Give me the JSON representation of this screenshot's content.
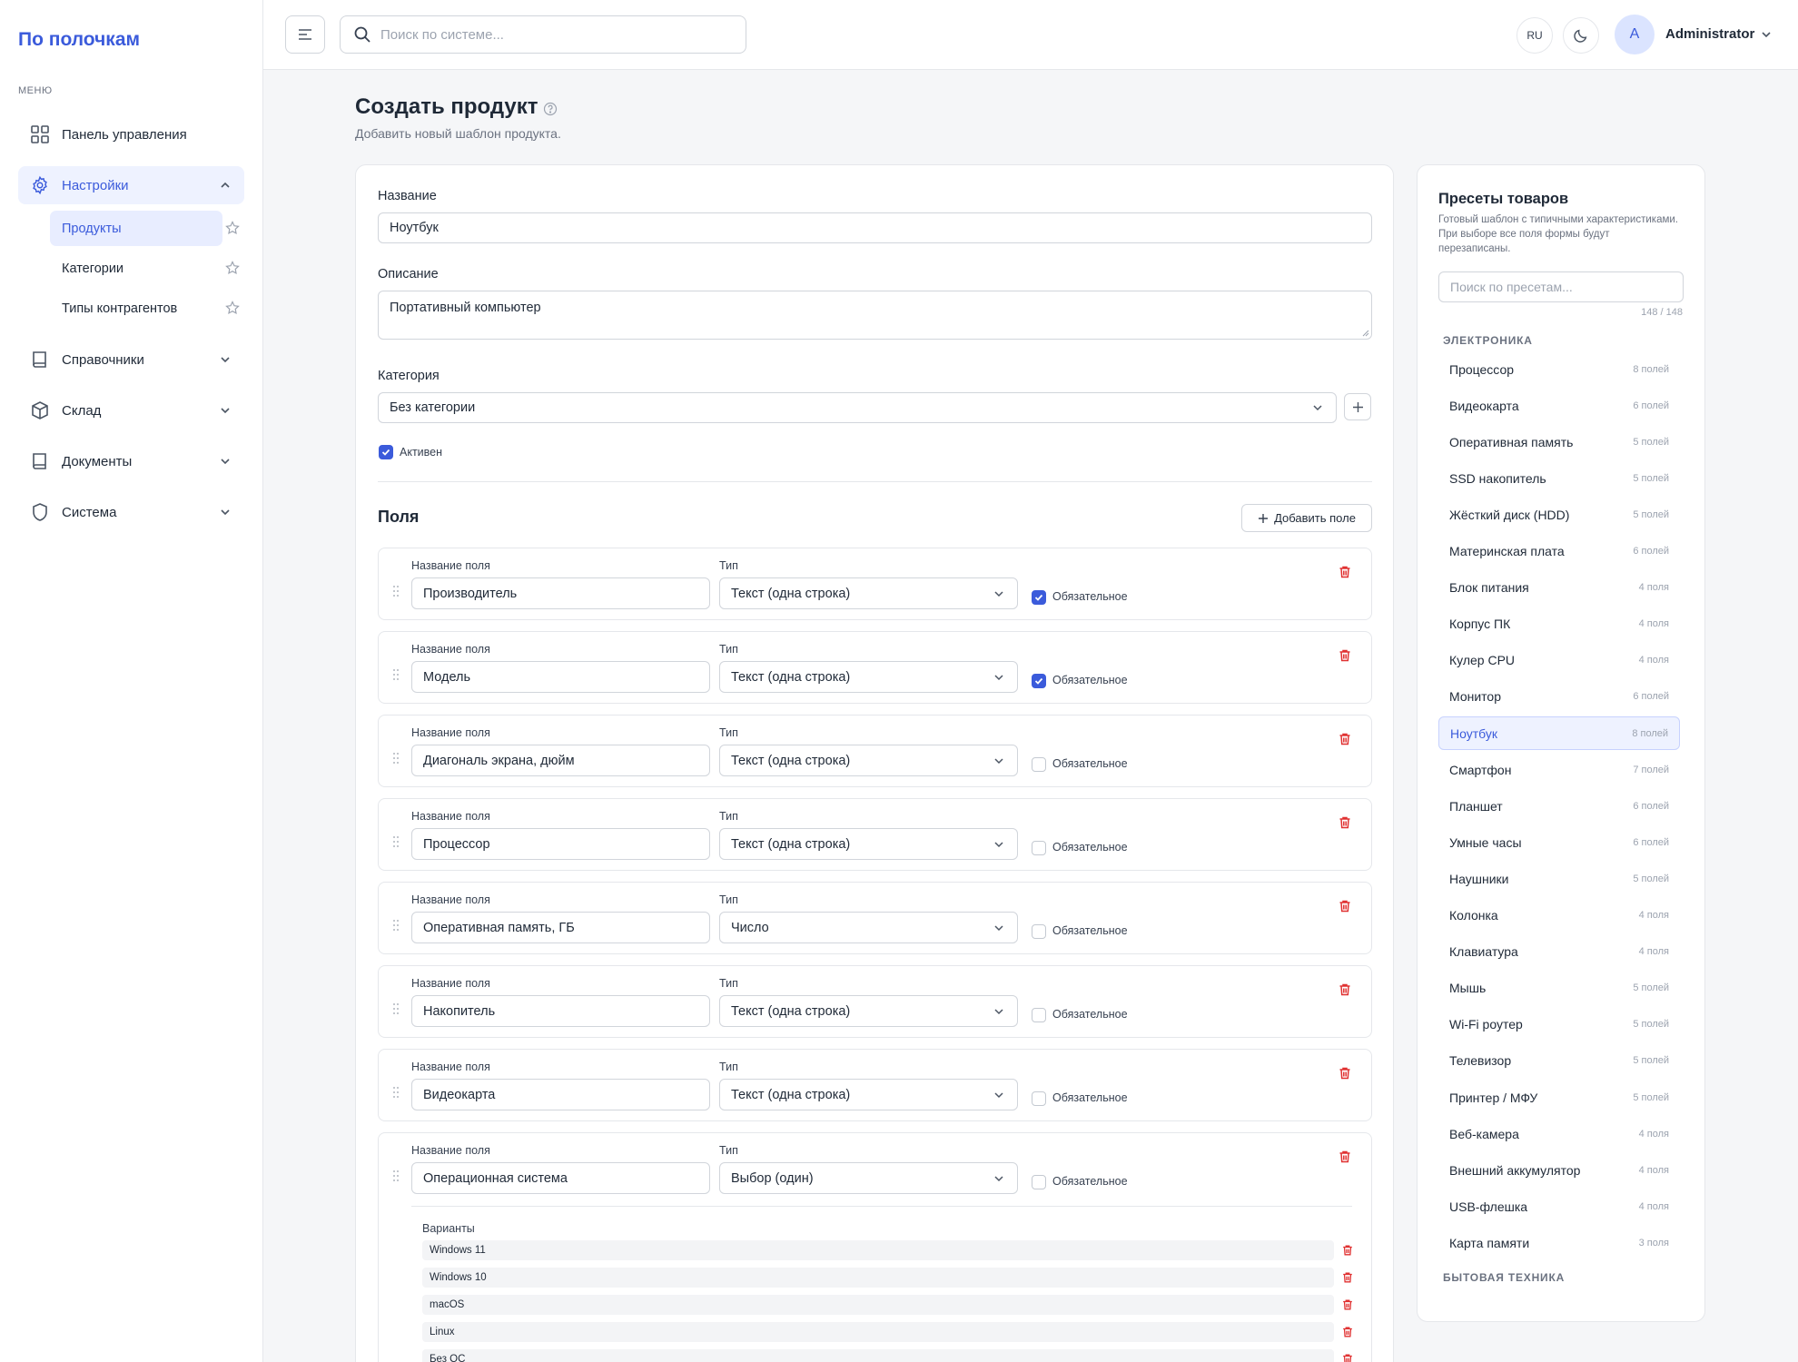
{
  "app": {
    "logo": "По полочкам",
    "menu_label": "МЕНЮ"
  },
  "nav": [
    {
      "label": "Панель управления",
      "icon": "dashboard-icon"
    },
    {
      "label": "Настройки",
      "icon": "gear-icon",
      "open": true,
      "children": [
        "Продукты",
        "Категории",
        "Типы контрагентов"
      ]
    },
    {
      "label": "Справочники",
      "icon": "book-icon"
    },
    {
      "label": "Склад",
      "icon": "box-icon"
    },
    {
      "label": "Документы",
      "icon": "document-icon"
    },
    {
      "label": "Система",
      "icon": "shield-icon"
    }
  ],
  "topbar": {
    "search_placeholder": "Поиск по системе...",
    "lang": "RU",
    "avatar_letter": "A",
    "username": "Administrator"
  },
  "page": {
    "title": "Создать продукт",
    "subtitle": "Добавить новый шаблон продукта."
  },
  "form": {
    "name_label": "Название",
    "name_value": "Ноутбук",
    "desc_label": "Описание",
    "desc_value": "Портативный компьютер",
    "category_label": "Категория",
    "category_value": "Без категории",
    "active_label": "Активен",
    "active": true,
    "fields_title": "Поля",
    "add_field_label": "Добавить поле",
    "field_name_label": "Название поля",
    "field_type_label": "Тип",
    "required_label": "Обязательное",
    "variants_label": "Варианты"
  },
  "fields": [
    {
      "name": "Производитель",
      "type": "Текст (одна строка)",
      "required": true
    },
    {
      "name": "Модель",
      "type": "Текст (одна строка)",
      "required": true
    },
    {
      "name": "Диагональ экрана, дюйм",
      "type": "Текст (одна строка)",
      "required": false
    },
    {
      "name": "Процессор",
      "type": "Текст (одна строка)",
      "required": false
    },
    {
      "name": "Оперативная память, ГБ",
      "type": "Число",
      "required": false
    },
    {
      "name": "Накопитель",
      "type": "Текст (одна строка)",
      "required": false
    },
    {
      "name": "Видеокарта",
      "type": "Текст (одна строка)",
      "required": false
    },
    {
      "name": "Операционная система",
      "type": "Выбор (один)",
      "required": false,
      "options": [
        "Windows 11",
        "Windows 10",
        "macOS",
        "Linux",
        "Без ОС"
      ]
    }
  ],
  "presets": {
    "title": "Пресеты товаров",
    "description": "Готовый шаблон с типичными характеристиками. При выборе все поля формы будут перезаписаны.",
    "search_placeholder": "Поиск по пресетам...",
    "count": "148 / 148",
    "group": "ЭЛЕКТРОНИКА",
    "next_group": "БЫТОВАЯ ТЕХНИКА",
    "items": [
      {
        "name": "Процессор",
        "count": "8 полей"
      },
      {
        "name": "Видеокарта",
        "count": "6 полей"
      },
      {
        "name": "Оперативная память",
        "count": "5 полей"
      },
      {
        "name": "SSD накопитель",
        "count": "5 полей"
      },
      {
        "name": "Жёсткий диск (HDD)",
        "count": "5 полей"
      },
      {
        "name": "Материнская плата",
        "count": "6 полей"
      },
      {
        "name": "Блок питания",
        "count": "4 поля"
      },
      {
        "name": "Корпус ПК",
        "count": "4 поля"
      },
      {
        "name": "Кулер CPU",
        "count": "4 поля"
      },
      {
        "name": "Монитор",
        "count": "6 полей"
      },
      {
        "name": "Ноутбук",
        "count": "8 полей",
        "selected": true
      },
      {
        "name": "Смартфон",
        "count": "7 полей"
      },
      {
        "name": "Планшет",
        "count": "6 полей"
      },
      {
        "name": "Умные часы",
        "count": "6 полей"
      },
      {
        "name": "Наушники",
        "count": "5 полей"
      },
      {
        "name": "Колонка",
        "count": "4 поля"
      },
      {
        "name": "Клавиатура",
        "count": "4 поля"
      },
      {
        "name": "Мышь",
        "count": "5 полей"
      },
      {
        "name": "Wi-Fi роутер",
        "count": "5 полей"
      },
      {
        "name": "Телевизор",
        "count": "5 полей"
      },
      {
        "name": "Принтер / МФУ",
        "count": "5 полей"
      },
      {
        "name": "Веб-камера",
        "count": "4 поля"
      },
      {
        "name": "Внешний аккумулятор",
        "count": "4 поля"
      },
      {
        "name": "USB-флешка",
        "count": "4 поля"
      },
      {
        "name": "Карта памяти",
        "count": "3 поля"
      }
    ]
  },
  "colors": {
    "accent": "#3b5bdb",
    "danger": "#e03131",
    "background": "#f5f6f8"
  }
}
